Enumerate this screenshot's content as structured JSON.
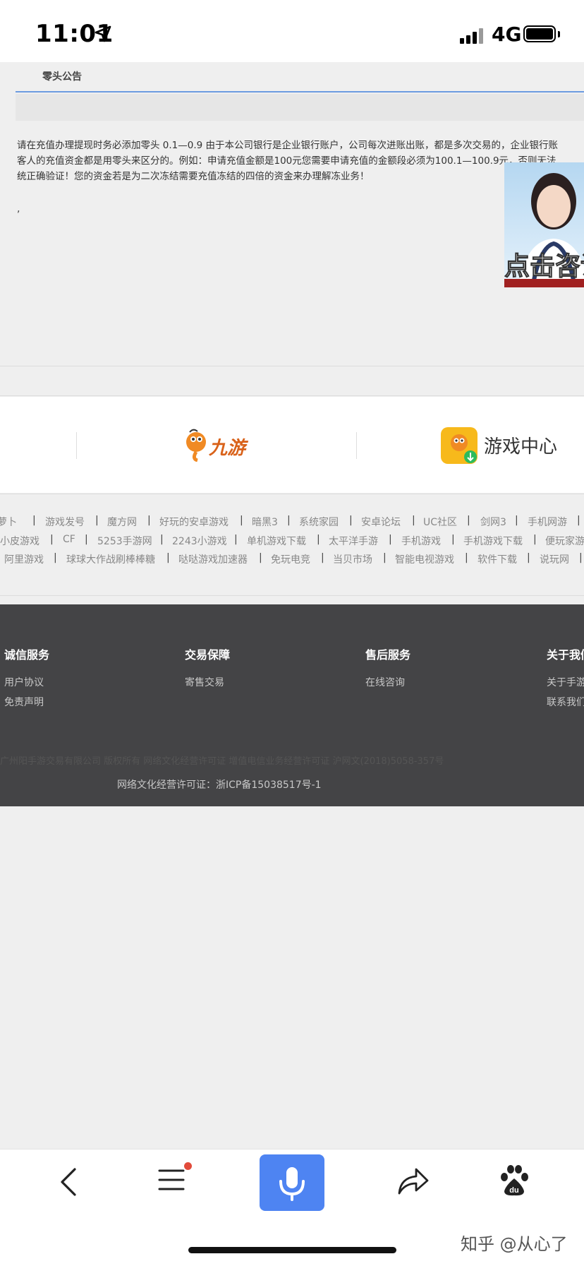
{
  "status_bar": {
    "time": "11:01",
    "network": "4G"
  },
  "notice": {
    "tab_label": "零头公告",
    "body_lines": [
      "请在充值办理提现时务必添加零头 0.1—0.9 由于本公司银行是企业银行账户，公司每次进账出账，都是多次交易的，企业银行账",
      "客人的充值资金都是用零头来区分的。例如：申请充值金额是100元您需要申请充值的金额段必须为100.1—100.9元，否则无法",
      "统正确验证！您的资金若是为二次冻结需要充值冻结的四倍的资金来办理解冻业务！"
    ],
    "trailing_mark": ",",
    "consult_label": "点击咨询"
  },
  "partners": {
    "jiuyou_label": "九游",
    "game_center_label": "游戏中心"
  },
  "link_rows": [
    [
      "萝卜",
      "游戏发号",
      "魔方网",
      "好玩的安卓游戏",
      "暗黑3",
      "系统家园",
      "安卓论坛",
      "UC社区",
      "剑网3",
      "手机网游"
    ],
    [
      "小皮游戏",
      "CF",
      "5253手游网",
      "2243小游戏",
      "单机游戏下载",
      "太平洋手游",
      "手机游戏",
      "手机游戏下载",
      "便玩家游"
    ],
    [
      "阿里游戏",
      "球球大作战刷棒棒糖",
      "哒哒游戏加速器",
      "免玩电竞",
      "当贝市场",
      "智能电视游戏",
      "软件下载",
      "说玩网"
    ]
  ],
  "footer": {
    "columns": [
      {
        "title": "诚信服务",
        "links": [
          "用户协议",
          "免责声明"
        ]
      },
      {
        "title": "交易保障",
        "links": [
          "寄售交易"
        ]
      },
      {
        "title": "售后服务",
        "links": [
          "在线咨询"
        ]
      },
      {
        "title": "关于我们",
        "links": [
          "关于手游",
          "联系我们"
        ]
      }
    ],
    "dim_line": "广州阳手游交易有限公司 版权所有 网络文化经营许可证 增值电信业务经营许可证 沪网文(2018)5058-357号",
    "icp_line": "网络文化经营许可证：浙ICP备15038517号-1"
  },
  "watermark": "知乎 @从心了",
  "colors": {
    "accent": "#4e84f2",
    "footer_bg": "#444446",
    "notification_dot": "#e24b3b",
    "game_center_icon": "#f7b91b"
  }
}
